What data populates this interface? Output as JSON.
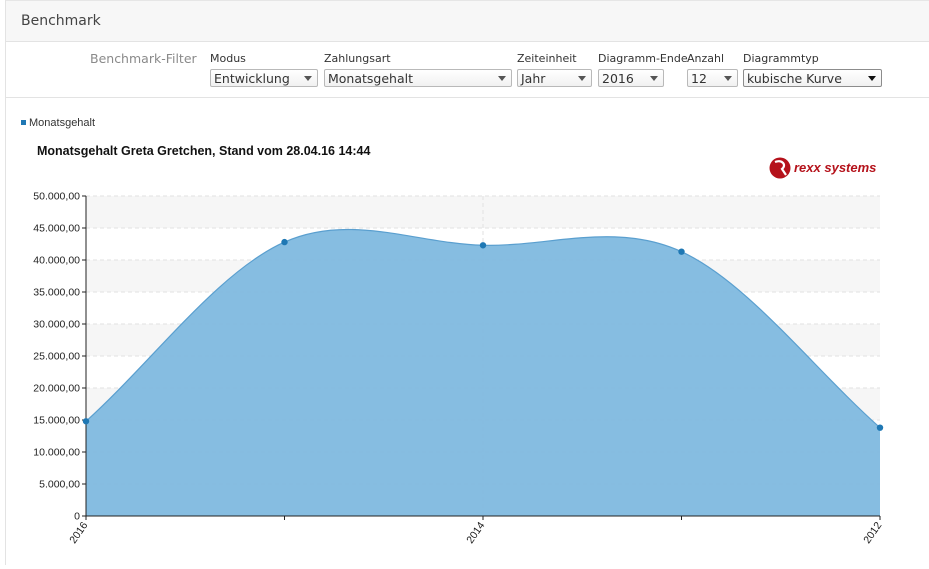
{
  "header": {
    "title": "Benchmark"
  },
  "filters": {
    "caption": "Benchmark-Filter",
    "modus": {
      "label": "Modus",
      "value": "Entwicklung"
    },
    "zahlungsart": {
      "label": "Zahlungsart",
      "value": "Monatsgehalt"
    },
    "zeiteinheit": {
      "label": "Zeiteinheit",
      "value": "Jahr"
    },
    "diagramm_ende": {
      "label": "Diagramm-Ende",
      "value": "2016"
    },
    "anzahl": {
      "label": "Anzahl",
      "value": "12"
    },
    "diagrammtyp": {
      "label": "Diagrammtyp",
      "value": "kubische Kurve"
    }
  },
  "logo": {
    "text": "rexx systems",
    "color": "#b5121b"
  },
  "chart_data": {
    "type": "area",
    "title": "Monatsgehalt Greta Gretchen, Stand vom 28.04.16 14:44",
    "legend": {
      "entries": [
        "Monatsgehalt"
      ],
      "position": "top-left"
    },
    "series": [
      {
        "name": "Monatsgehalt",
        "x": [
          0,
          1,
          2,
          3,
          4
        ],
        "values": [
          14800,
          42800,
          42300,
          41300,
          13800
        ]
      }
    ],
    "x_ticks": [
      {
        "x": 0,
        "label": "2016"
      },
      {
        "x": 2,
        "label": "2014"
      },
      {
        "x": 4,
        "label": "2012"
      }
    ],
    "xlim": [
      0,
      4
    ],
    "ylim": [
      0,
      50000
    ],
    "y_ticks": [
      "0",
      "5.000,00",
      "10.000,00",
      "15.000,00",
      "20.000,00",
      "25.000,00",
      "30.000,00",
      "35.000,00",
      "40.000,00",
      "45.000,00",
      "50.000,00"
    ],
    "grid": true,
    "colors": {
      "fill": "#7fb9df",
      "line": "#5a9fcf",
      "point": "#1f78b4",
      "legend": "#1f78b4"
    }
  }
}
